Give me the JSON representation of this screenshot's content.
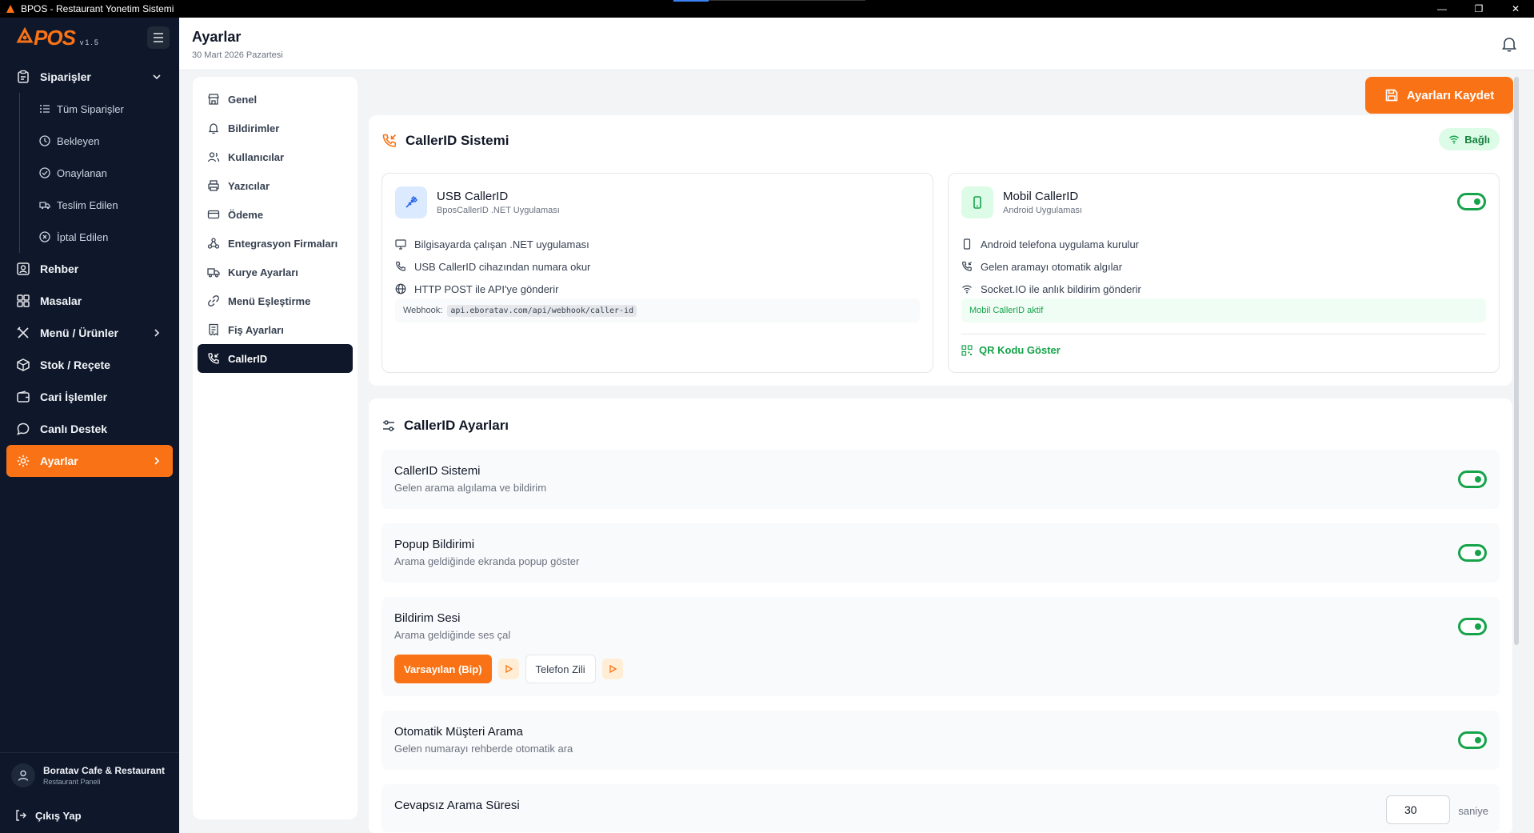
{
  "window": {
    "title": "BPOS - Restaurant Yonetim Sistemi"
  },
  "brand": {
    "logo_text": "POS",
    "version": "v1.5",
    "accent": "#f97316",
    "sidebar_bg": "#0f172a",
    "success": "#16a34a"
  },
  "sidebar": {
    "items": [
      {
        "label": "Siparişler",
        "icon": "clipboard-icon",
        "chevron": "down"
      },
      {
        "label": "Rehber",
        "icon": "user-square-icon"
      },
      {
        "label": "Masalar",
        "icon": "grid-icon"
      },
      {
        "label": "Menü / Ürünler",
        "icon": "utensils-icon",
        "chevron": "right"
      },
      {
        "label": "Stok / Reçete",
        "icon": "box-icon"
      },
      {
        "label": "Cari İşlemler",
        "icon": "wallet-icon"
      },
      {
        "label": "Canlı Destek",
        "icon": "chat-icon"
      },
      {
        "label": "Ayarlar",
        "icon": "gear-icon",
        "chevron": "right",
        "active": true
      }
    ],
    "order_subitems": [
      {
        "label": "Tüm Siparişler",
        "icon": "list-icon"
      },
      {
        "label": "Bekleyen",
        "icon": "clock-icon"
      },
      {
        "label": "Onaylanan",
        "icon": "check-circle-icon"
      },
      {
        "label": "Teslim Edilen",
        "icon": "truck-icon"
      },
      {
        "label": "İptal Edilen",
        "icon": "x-circle-icon"
      }
    ],
    "profile": {
      "name": "Boratav Cafe & Restaurant",
      "role": "Restaurant Paneli"
    },
    "logout_label": "Çıkış Yap"
  },
  "header": {
    "title": "Ayarlar",
    "date": "30 Mart 2026 Pazartesi"
  },
  "settings_nav": {
    "items": [
      {
        "label": "Genel",
        "icon": "store-icon"
      },
      {
        "label": "Bildirimler",
        "icon": "bell-icon"
      },
      {
        "label": "Kullanıcılar",
        "icon": "users-icon"
      },
      {
        "label": "Yazıcılar",
        "icon": "printer-icon"
      },
      {
        "label": "Ödeme",
        "icon": "credit-card-icon"
      },
      {
        "label": "Entegrasyon Firmaları",
        "icon": "network-icon"
      },
      {
        "label": "Kurye Ayarları",
        "icon": "truck-icon"
      },
      {
        "label": "Menü Eşleştirme",
        "icon": "link-icon"
      },
      {
        "label": "Fiş Ayarları",
        "icon": "receipt-icon"
      },
      {
        "label": "CallerID",
        "icon": "phone-incoming-icon",
        "active": true
      }
    ]
  },
  "toolbar": {
    "save_label": "Ayarları Kaydet"
  },
  "callerid_system": {
    "title": "CallerID Sistemi",
    "status": "Bağlı",
    "usb": {
      "title": "USB CallerID",
      "subtitle": "BposCallerID .NET Uygulaması",
      "features": [
        "Bilgisayarda çalışan .NET uygulaması",
        "USB CallerID cihazından numara okur",
        "HTTP POST ile API'ye gönderir"
      ],
      "webhook_label": "Webhook:",
      "webhook_url": "api.eboratav.com/api/webhook/caller-id"
    },
    "mobile": {
      "title": "Mobil CallerID",
      "subtitle": "Android Uygulaması",
      "enabled": true,
      "features": [
        "Android telefona uygulama kurulur",
        "Gelen aramayı otomatik algılar",
        "Socket.IO ile anlık bildirim gönderir"
      ],
      "status": "Mobil CallerID aktif",
      "qr_label": "QR Kodu Göster"
    }
  },
  "callerid_settings": {
    "title": "CallerID Ayarları",
    "rows": [
      {
        "title": "CallerID Sistemi",
        "desc": "Gelen arama algılama ve bildirim",
        "enabled": true
      },
      {
        "title": "Popup Bildirimi",
        "desc": "Arama geldiğinde ekranda popup göster",
        "enabled": true
      },
      {
        "title": "Bildirim Sesi",
        "desc": "Arama geldiğinde ses çal",
        "enabled": true
      },
      {
        "title": "Otomatik Müşteri Arama",
        "desc": "Gelen numarayı rehberde otomatik ara",
        "enabled": true
      },
      {
        "title": "Cevapsız Arama Süresi",
        "value": "30",
        "unit": "saniye"
      }
    ],
    "sound_options": [
      "Varsayılan (Bip)",
      "Telefon Zili"
    ],
    "selected_sound": "Varsayılan (Bip)"
  }
}
